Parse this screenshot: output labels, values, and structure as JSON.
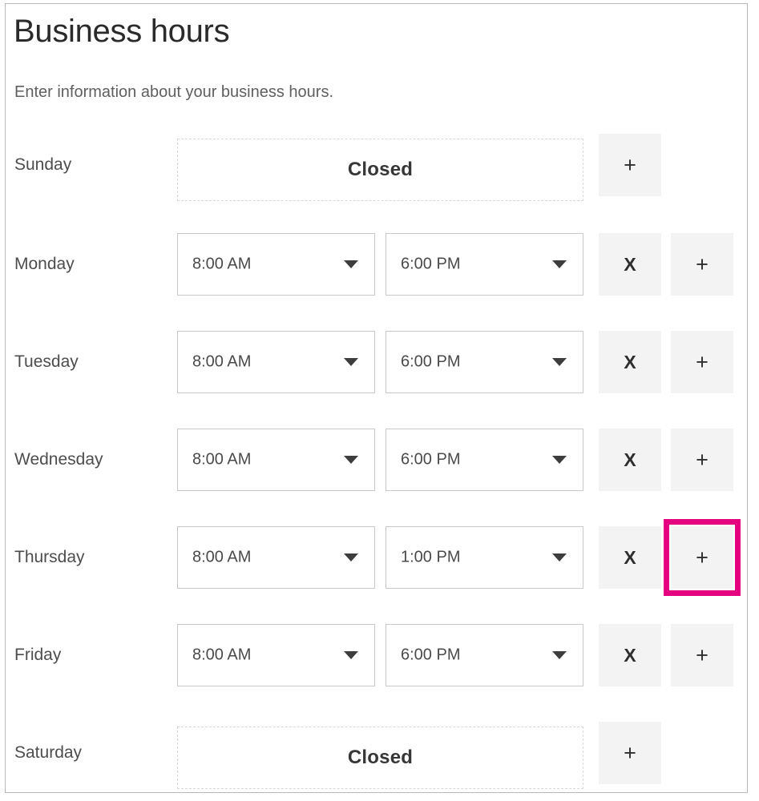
{
  "page": {
    "title": "Business hours",
    "subtitle": "Enter information about your business hours."
  },
  "labels": {
    "closed": "Closed",
    "remove_glyph": "X",
    "add_glyph": "+"
  },
  "colors": {
    "highlight": "#e4007e",
    "button_background": "#f3f3f3",
    "panel_border": "#b9b9b9",
    "field_border": "#c8c8c8",
    "dashed_border": "#d8d8d8",
    "title_text": "#2a2a2a",
    "subtitle_text": "#5f5f5f",
    "day_label_text": "#4d4d4d"
  },
  "rows": [
    {
      "day": "Sunday",
      "status": "closed",
      "open_time": null,
      "close_time": null,
      "has_remove": false,
      "has_add": true,
      "add_highlighted": false
    },
    {
      "day": "Monday",
      "status": "open",
      "open_time": "8:00 AM",
      "close_time": "6:00 PM",
      "has_remove": true,
      "has_add": true,
      "add_highlighted": false
    },
    {
      "day": "Tuesday",
      "status": "open",
      "open_time": "8:00 AM",
      "close_time": "6:00 PM",
      "has_remove": true,
      "has_add": true,
      "add_highlighted": false
    },
    {
      "day": "Wednesday",
      "status": "open",
      "open_time": "8:00 AM",
      "close_time": "6:00 PM",
      "has_remove": true,
      "has_add": true,
      "add_highlighted": false
    },
    {
      "day": "Thursday",
      "status": "open",
      "open_time": "8:00 AM",
      "close_time": "1:00 PM",
      "has_remove": true,
      "has_add": true,
      "add_highlighted": true
    },
    {
      "day": "Friday",
      "status": "open",
      "open_time": "8:00 AM",
      "close_time": "6:00 PM",
      "has_remove": true,
      "has_add": true,
      "add_highlighted": false
    },
    {
      "day": "Saturday",
      "status": "closed",
      "open_time": null,
      "close_time": null,
      "has_remove": false,
      "has_add": true,
      "add_highlighted": false
    }
  ]
}
